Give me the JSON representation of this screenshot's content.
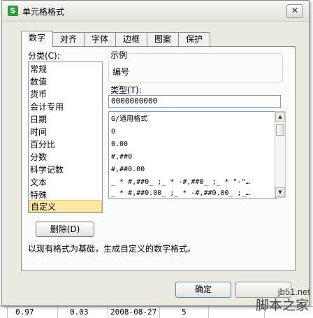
{
  "window": {
    "title": "单元格格式",
    "close_glyph": "✕",
    "app_icon_letter": "S"
  },
  "tabs": [
    {
      "label": "数字",
      "active": true
    },
    {
      "label": "对齐",
      "active": false
    },
    {
      "label": "字体",
      "active": false
    },
    {
      "label": "边框",
      "active": false
    },
    {
      "label": "图案",
      "active": false
    },
    {
      "label": "保护",
      "active": false
    }
  ],
  "category": {
    "label": "分类(C):",
    "items": [
      "常规",
      "数值",
      "货币",
      "会计专用",
      "日期",
      "时间",
      "百分比",
      "分数",
      "科学记数",
      "文本",
      "特殊",
      "自定义"
    ],
    "selected": "自定义"
  },
  "sample": {
    "label": "示例",
    "value": "编号"
  },
  "type": {
    "label": "类型(T):",
    "value": "0000000000",
    "formats": [
      "G/通用格式",
      "0",
      "0.00",
      "#,##0",
      "#,##0.00",
      "_ * #,##0_ ;_ * -#,##0_ ;_ * \"-\"…",
      "_ * #,##0.00_ ;_ * -#,##0.00_ ;_…"
    ]
  },
  "delete_button": "删除(D)",
  "description": "以现有格式为基础，生成自定义的数字格式。",
  "buttons": {
    "ok": "确定"
  },
  "sheet": {
    "bottom_row": [
      "0.97",
      "0.03",
      "2008-08-27",
      "5"
    ]
  },
  "watermark": {
    "url": "jb51.net",
    "name": "脚本之家"
  },
  "colors": {
    "selection": "#ffe8a6",
    "app_icon": "#2e9b3a"
  }
}
